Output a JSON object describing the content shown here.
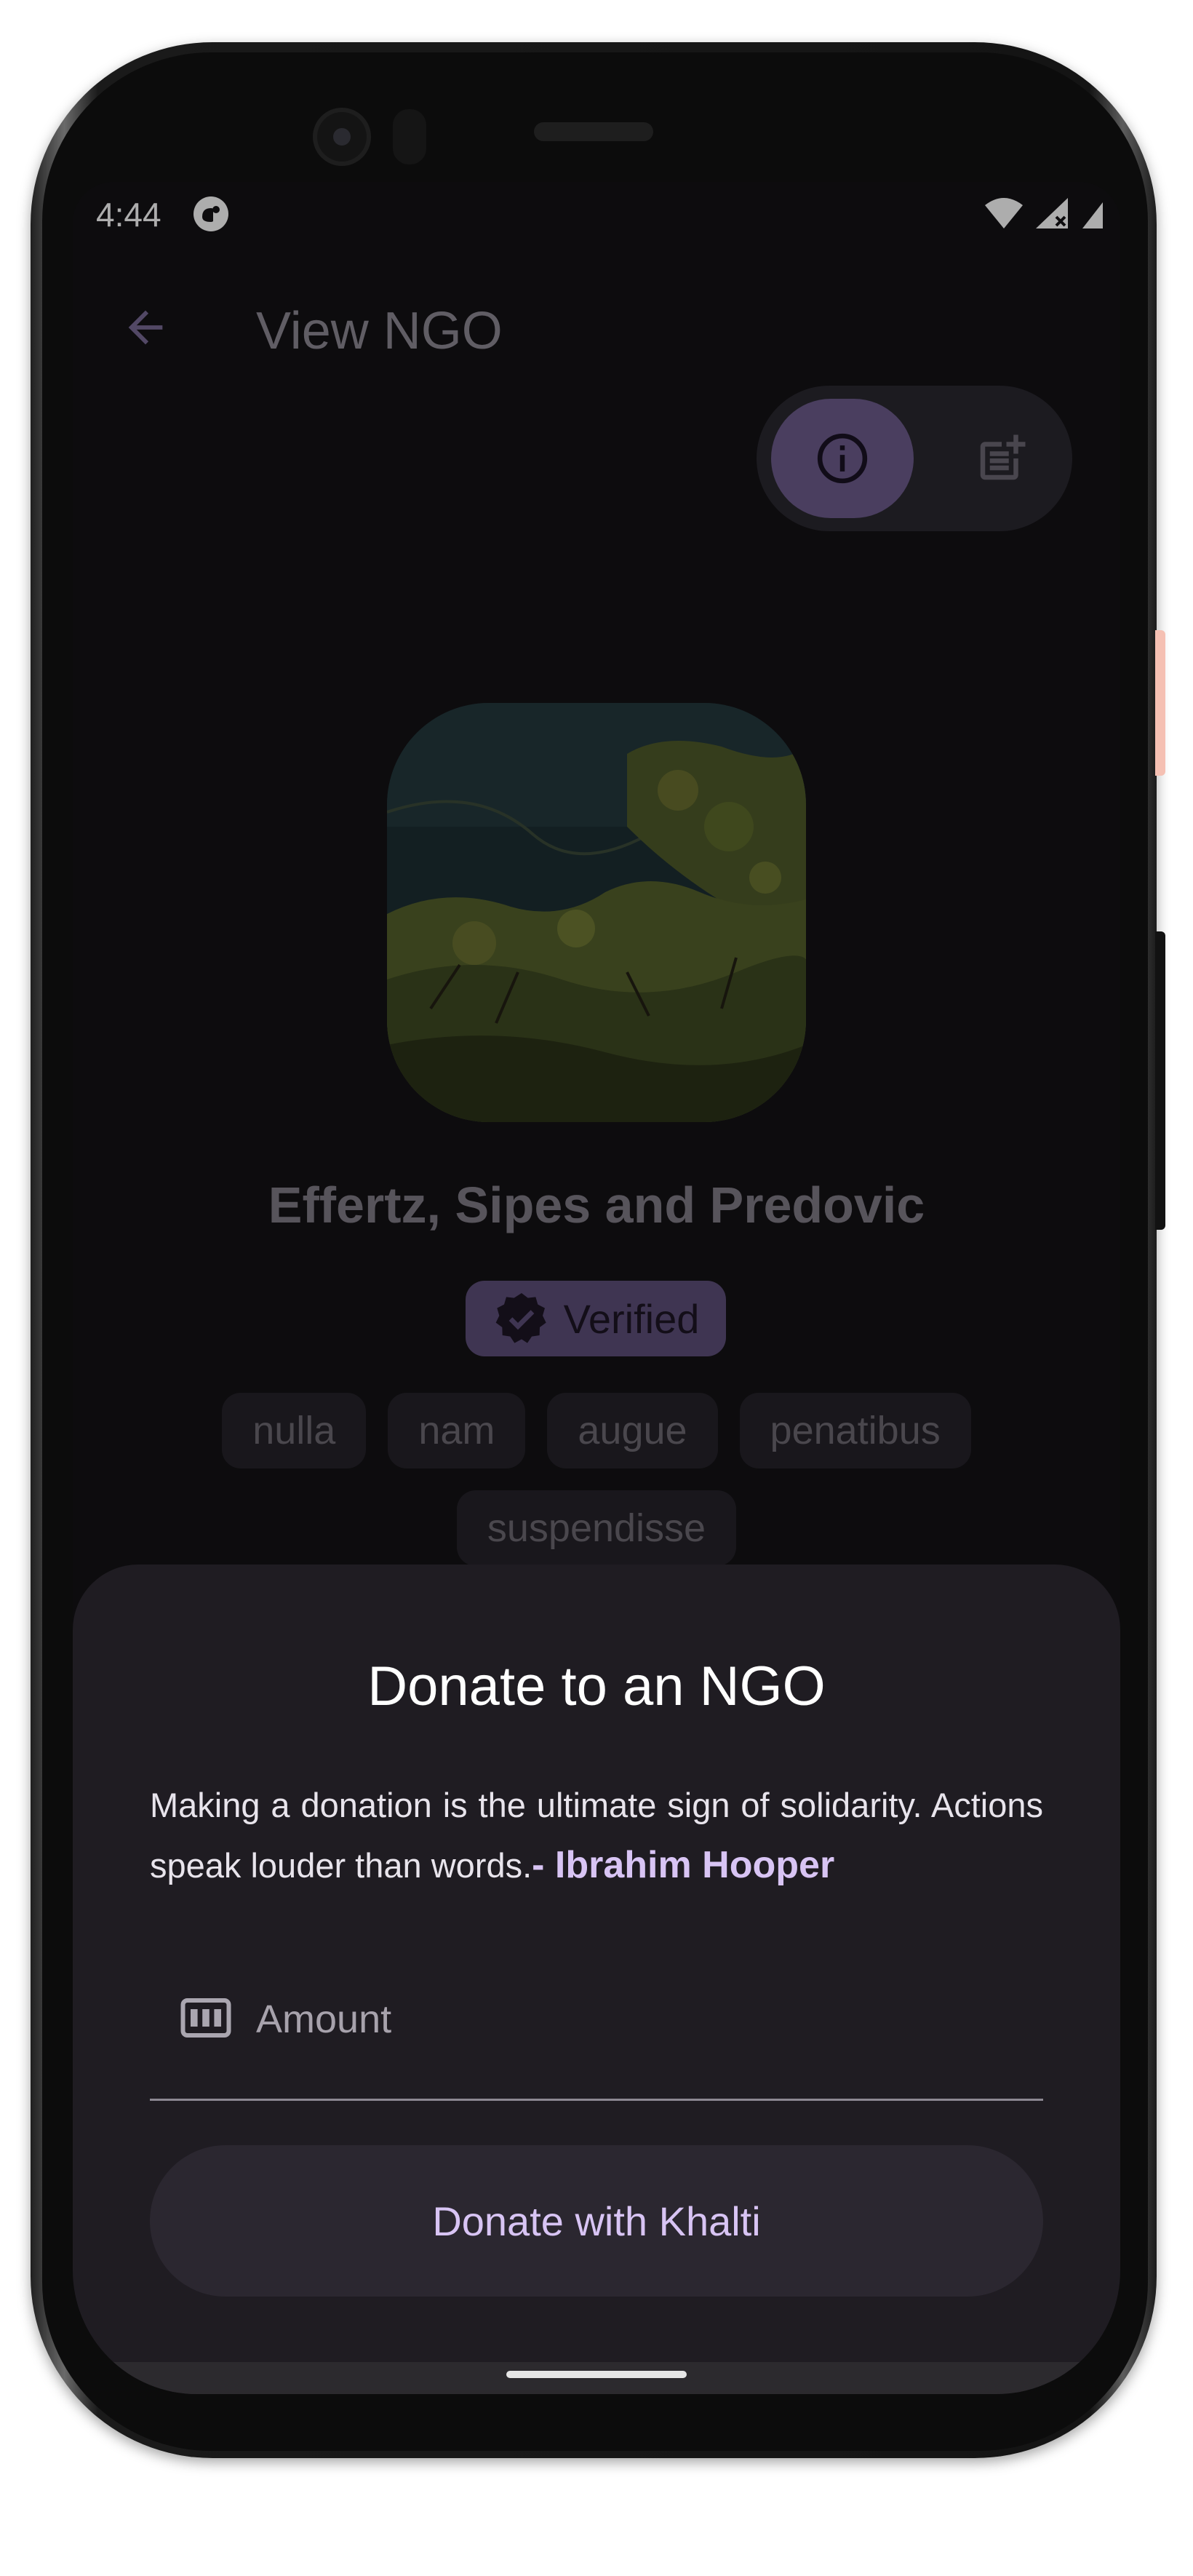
{
  "status_bar": {
    "time": "4:44",
    "icons": [
      "app-notification-icon",
      "wifi-icon",
      "cellular-signal-icon",
      "battery-icon"
    ]
  },
  "app_bar": {
    "title": "View NGO",
    "back_icon": "arrow-back-icon"
  },
  "view_toggle": {
    "selected": "info",
    "items": [
      {
        "id": "info",
        "icon": "info-icon"
      },
      {
        "id": "posts",
        "icon": "post-add-icon"
      }
    ]
  },
  "ngo": {
    "name": "Effertz, Sipes and Predovic",
    "verified_label": "Verified",
    "tags": [
      "nulla",
      "nam",
      "augue",
      "penatibus",
      "suspendisse"
    ]
  },
  "donate_sheet": {
    "title": "Donate to an NGO",
    "quote": "Making a donation is the ultimate sign of solidarity. Actions speak louder than words.",
    "quote_author": "- Ibrahim Hooper",
    "amount_placeholder": "Amount",
    "amount_value": "",
    "donate_button_label": "Donate with Khalti"
  },
  "colors": {
    "accent": "#d8c4f4",
    "sheet_background": "#1f1c22",
    "screen_background": "#141216"
  }
}
